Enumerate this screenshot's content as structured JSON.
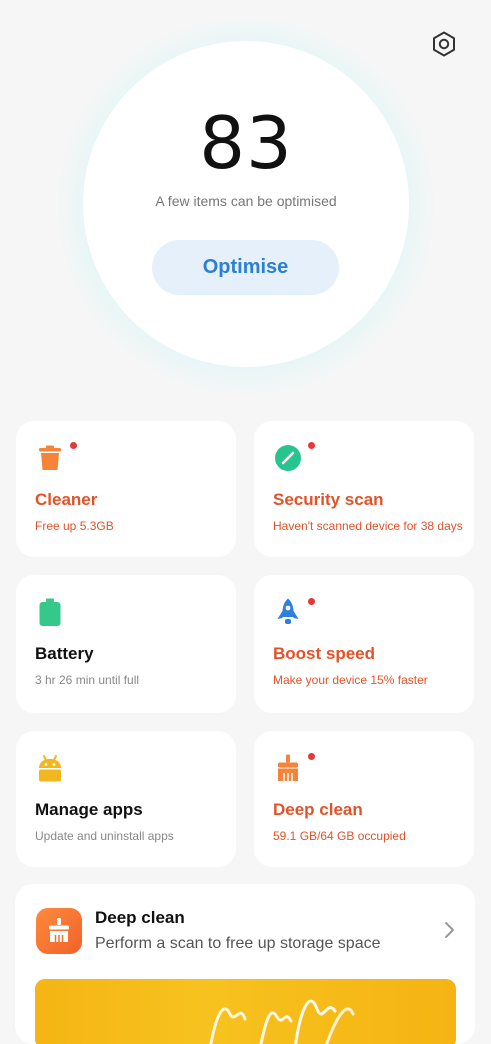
{
  "header": {
    "settings_icon": "settings-hexagon-icon"
  },
  "score": {
    "value": "83",
    "description": "A few items can be optimised",
    "button_label": "Optimise",
    "glow_color": "#a5eef0"
  },
  "cards": [
    {
      "title": "Cleaner",
      "subtitle": "Free up 5.3GB",
      "icon": "trash-can-icon",
      "alert": true
    },
    {
      "title": "Security scan",
      "subtitle": "Haven't scanned device for 38 days",
      "icon": "security-scan-icon",
      "alert": true
    },
    {
      "title": "Battery",
      "subtitle": "3 hr 26 min  until full",
      "icon": "battery-icon",
      "alert": false
    },
    {
      "title": "Boost speed",
      "subtitle": "Make your device 15% faster",
      "icon": "rocket-icon",
      "alert": true
    },
    {
      "title": "Manage apps",
      "subtitle": "Update and uninstall apps",
      "icon": "android-apps-icon",
      "alert": false
    },
    {
      "title": "Deep clean",
      "subtitle": "59.1 GB/64 GB occupied",
      "icon": "broom-icon",
      "alert": true
    }
  ],
  "deep_clean_banner": {
    "title": "Deep clean",
    "subtitle": "Perform a scan to free up storage space",
    "icon": "broom-icon",
    "action_icon": "chevron-right-icon"
  },
  "colors": {
    "alert": "#e2532a",
    "accent_blue": "#2d7fd2",
    "badge_dot": "#e53935"
  }
}
